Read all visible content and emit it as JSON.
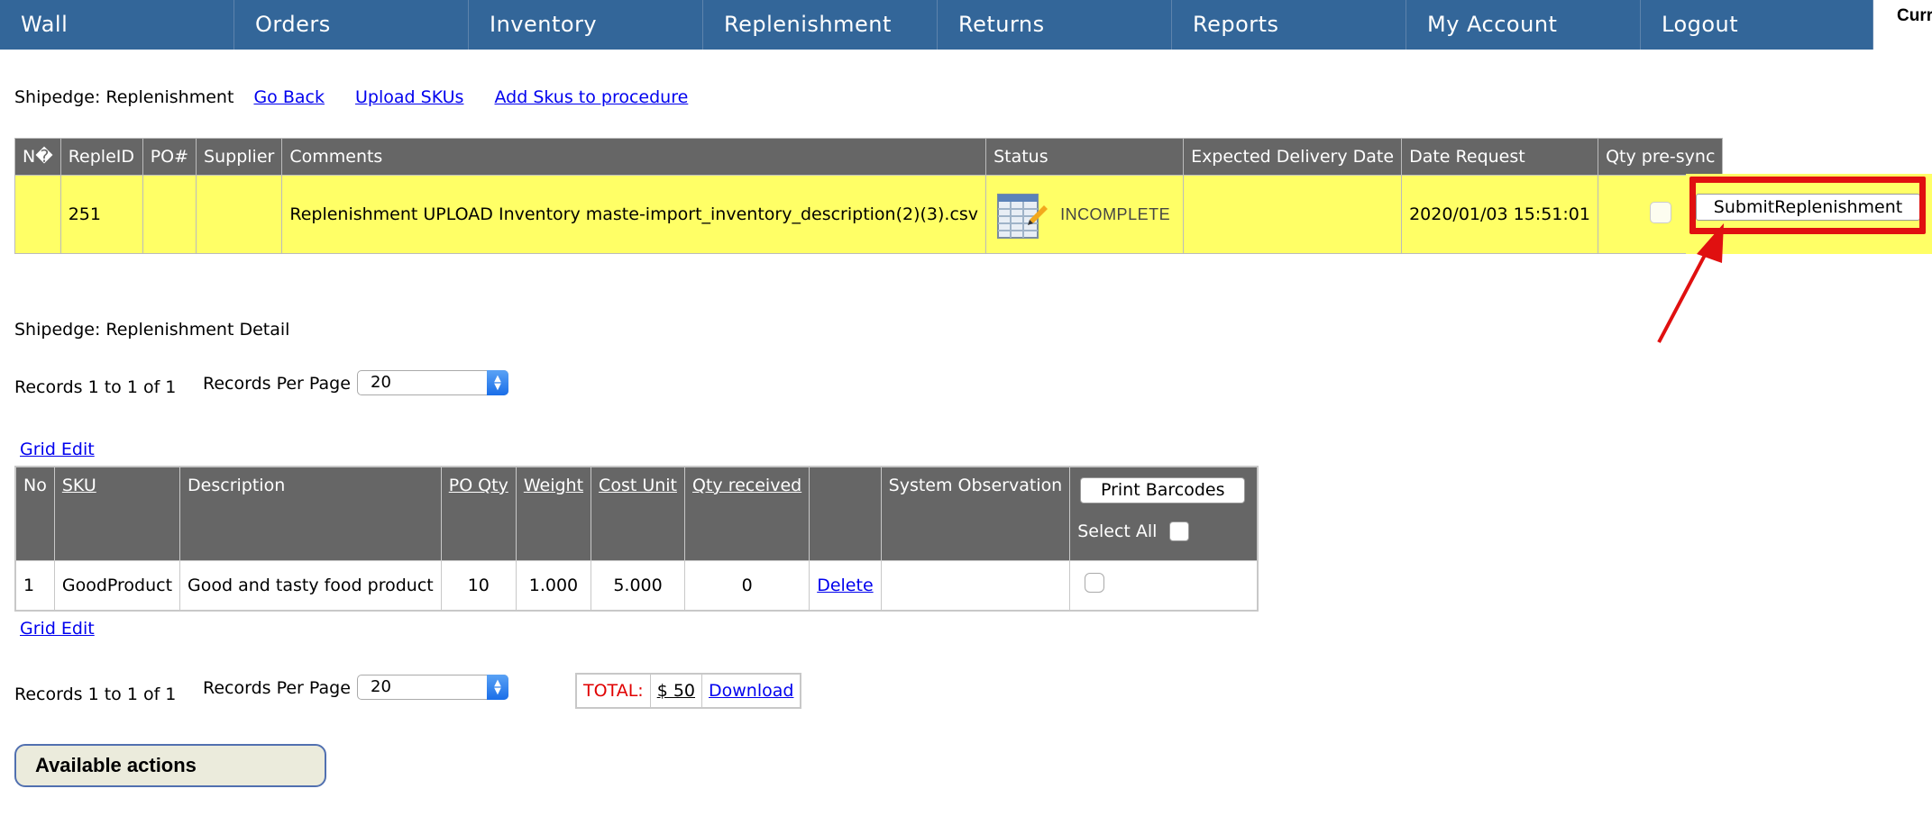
{
  "nav": {
    "items": [
      "Wall",
      "Orders",
      "Inventory",
      "Replenishment",
      "Returns",
      "Reports",
      "My Account",
      "Logout"
    ],
    "user_label": "Curr"
  },
  "header": {
    "title": "Shipedge: Replenishment",
    "links": [
      "Go Back",
      "Upload SKUs",
      "Add Skus to procedure"
    ]
  },
  "replenishment_table": {
    "columns": [
      "N�",
      "RepleID",
      "PO#",
      "Supplier",
      "Comments",
      "Status",
      "Expected Delivery Date",
      "Date Request",
      "Qty pre-sync"
    ],
    "row": {
      "n": "",
      "reple_id": "251",
      "po": "",
      "supplier": "",
      "comments": "Replenishment UPLOAD Inventory maste-import_inventory_description(2)(3).csv",
      "status": "INCOMPLETE",
      "expected_delivery": "",
      "date_request": "2020/01/03 15:51:01"
    },
    "submit_label": "SubmitReplenishment"
  },
  "detail": {
    "title": "Shipedge: Replenishment Detail",
    "records_text": "Records 1 to 1 of 1",
    "per_page_label": "Records Per Page",
    "per_page_value": "20",
    "grid_edit": "Grid Edit",
    "columns": [
      "No",
      "SKU",
      "Description",
      "PO Qty",
      "Weight",
      "Cost Unit",
      "Qty received",
      "",
      "System Observation"
    ],
    "print_barcodes": "Print Barcodes",
    "select_all": "Select All",
    "row": {
      "no": "1",
      "sku": "GoodProduct",
      "description": "Good and tasty food product",
      "po_qty": "10",
      "weight": "1.000",
      "cost_unit": "5.000",
      "qty_received": "0",
      "delete": "Delete",
      "observation": ""
    },
    "total_label": "TOTAL:",
    "total_value": "$ 50",
    "download": "Download",
    "available_actions": "Available actions"
  },
  "colors": {
    "nav_bg": "#336699",
    "header_bg": "#666666",
    "row_highlight": "#ffff66",
    "annotation_red": "#e01010"
  },
  "icons": [
    "spreadsheet-status-icon",
    "arrow-annotation-icon",
    "select-arrows-icon"
  ]
}
